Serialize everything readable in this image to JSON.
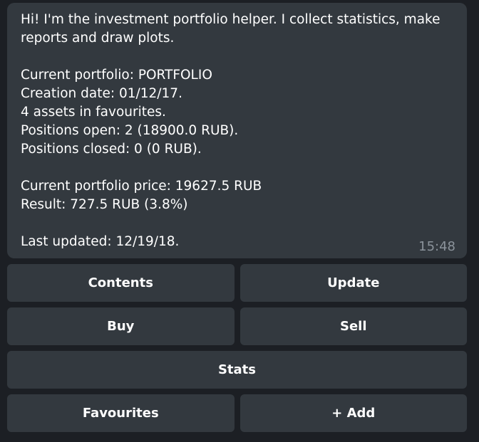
{
  "message": {
    "lines": [
      "Hi! I'm the investment portfolio helper. I collect statistics, make",
      "reports and draw plots.",
      "",
      "Current portfolio: PORTFOLIO",
      "Creation date: 01/12/17.",
      "4 assets in favourites.",
      "Positions open: 2 (18900.0 RUB).",
      "Positions closed: 0 (0 RUB).",
      "",
      "Current portfolio price: 19627.5 RUB",
      "Result: 727.5 RUB (3.8%)",
      "",
      "Last updated: 12/19/18."
    ],
    "time": "15:48"
  },
  "keyboard": {
    "contents": "Contents",
    "update": "Update",
    "buy": "Buy",
    "sell": "Sell",
    "stats": "Stats",
    "favourites": "Favourites",
    "add": "+ Add"
  }
}
